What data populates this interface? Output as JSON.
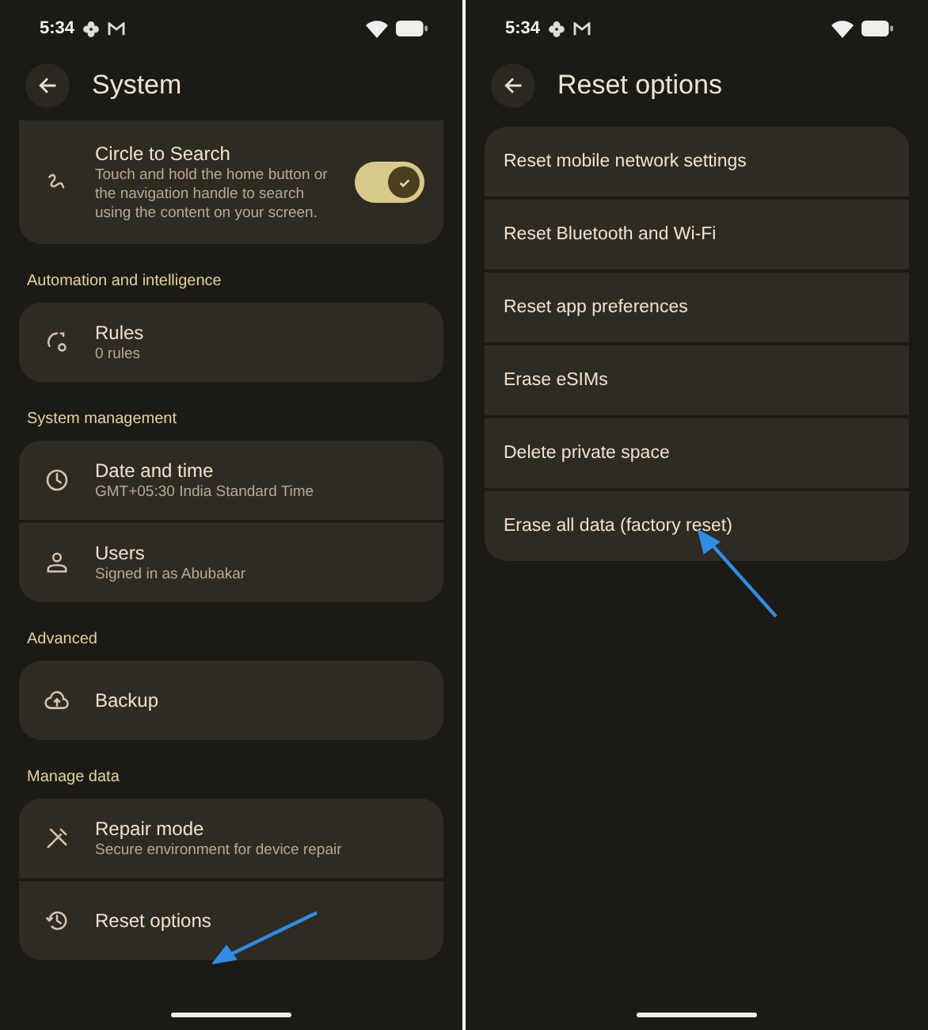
{
  "screens": [
    {
      "status_bar": {
        "time": "5:34"
      },
      "title": "System",
      "groups": [
        {
          "items": [
            {
              "title": "Circle to Search",
              "subtitle": "Touch and hold the home button or the navigation handle to search using the content on your screen.",
              "toggle": {
                "checked": true
              }
            }
          ]
        },
        {
          "header": "Automation and intelligence",
          "items": [
            {
              "title": "Rules",
              "subtitle": "0 rules"
            }
          ]
        },
        {
          "header": "System management",
          "items": [
            {
              "title": "Date and time",
              "subtitle": "GMT+05:30 India Standard Time"
            },
            {
              "title": "Users",
              "subtitle": "Signed in as Abubakar"
            }
          ]
        },
        {
          "header": "Advanced",
          "items": [
            {
              "title": "Backup"
            }
          ]
        },
        {
          "header": "Manage data",
          "items": [
            {
              "title": "Repair mode",
              "subtitle": "Secure environment for device repair"
            },
            {
              "title": "Reset options"
            }
          ]
        }
      ]
    },
    {
      "status_bar": {
        "time": "5:34"
      },
      "title": "Reset options",
      "options": [
        {
          "label": "Reset mobile network settings"
        },
        {
          "label": "Reset Bluetooth and Wi-Fi"
        },
        {
          "label": "Reset app preferences"
        },
        {
          "label": "Erase eSIMs"
        },
        {
          "label": "Delete private space"
        },
        {
          "label": "Erase all data (factory reset)"
        }
      ]
    }
  ]
}
